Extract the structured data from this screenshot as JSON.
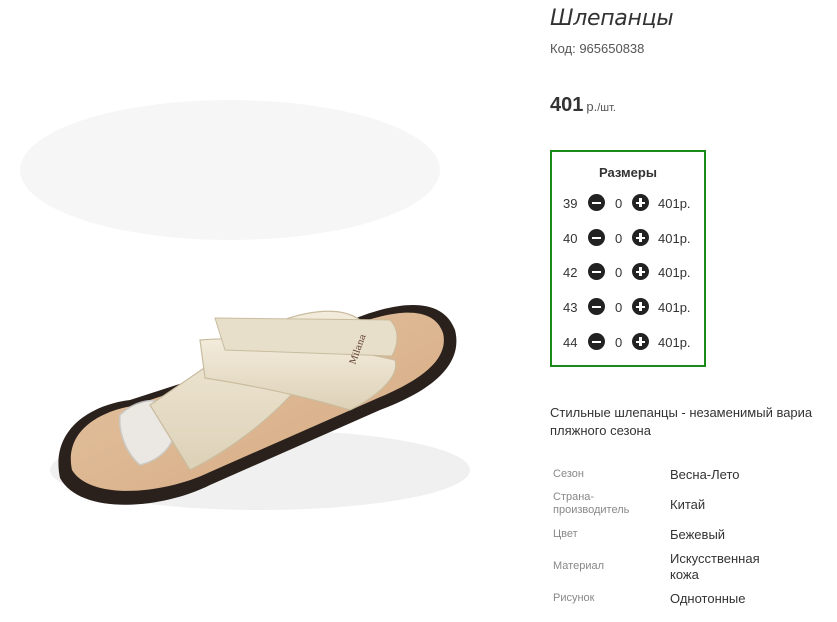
{
  "product": {
    "title": "Шлепанцы",
    "code": "Код: 965650838",
    "price_value": "401",
    "price_currency": "р.",
    "price_unit": "/шт.",
    "image_icon": "sandal-photo"
  },
  "sizes": {
    "title": "Размеры",
    "rows": [
      {
        "size": "39",
        "qty": "0",
        "price": "401р."
      },
      {
        "size": "40",
        "qty": "0",
        "price": "401р."
      },
      {
        "size": "42",
        "qty": "0",
        "price": "401р."
      },
      {
        "size": "43",
        "qty": "0",
        "price": "401р."
      },
      {
        "size": "44",
        "qty": "0",
        "price": "401р."
      }
    ],
    "minus_icon": "minus-circle-icon",
    "plus_icon": "plus-circle-icon"
  },
  "description": {
    "line1": "Стильные шлепанцы - незаменимый вариа",
    "line2": "пляжного сезона"
  },
  "properties": [
    {
      "key": "Сезон",
      "value": "Весна-Лето"
    },
    {
      "key": "Страна-производитель",
      "value": "Китай"
    },
    {
      "key": "Цвет",
      "value": "Бежевый"
    },
    {
      "key": "Материал",
      "value": "Искусственная кожа"
    },
    {
      "key": "Рисунок",
      "value": "Однотонные"
    }
  ],
  "colors": {
    "accent_border": "#1a8a1a",
    "button": "#222222"
  }
}
